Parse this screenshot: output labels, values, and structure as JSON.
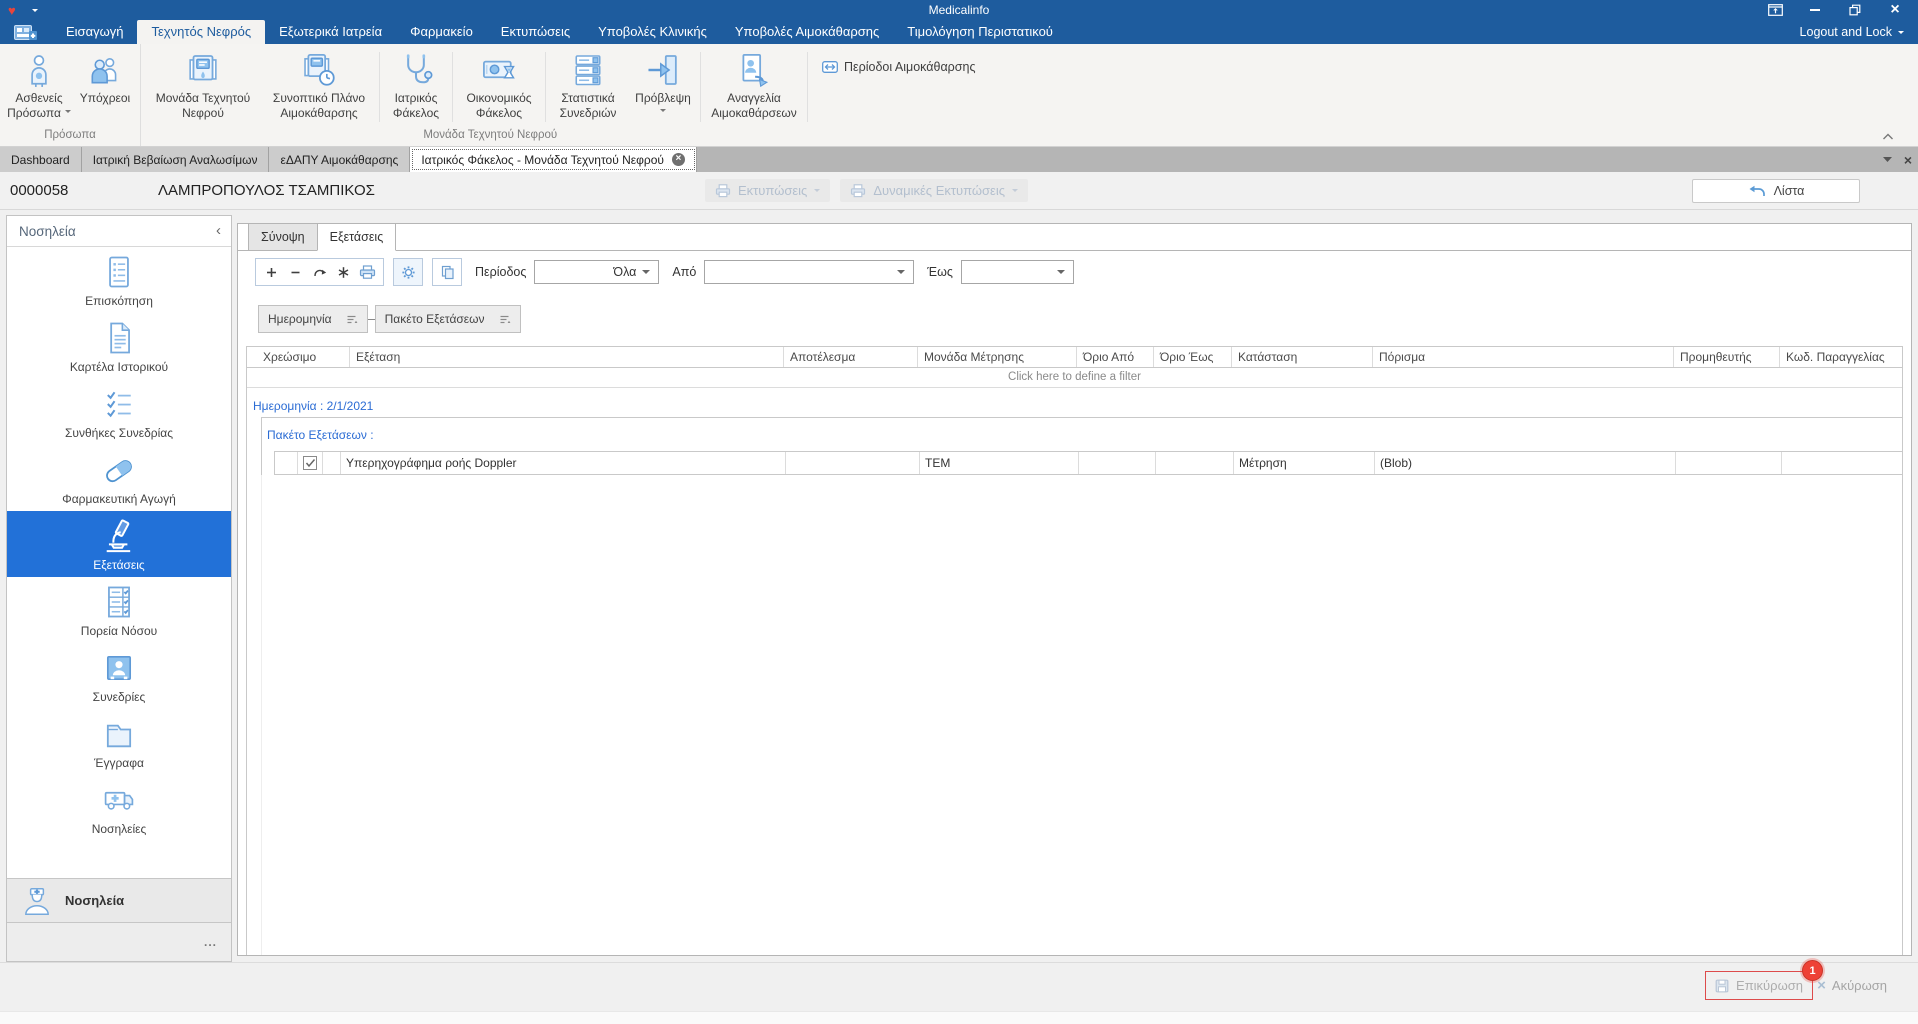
{
  "colors": {
    "titlebar_blue": "#1e5c9e",
    "selection_blue": "#2271d8",
    "link_blue": "#2b6cd4",
    "badge_red": "#ee4136",
    "icon_blue": "#76a9dc"
  },
  "titlebar": {
    "app_title": "Medicalinfo",
    "logout_label": "Logout and Lock"
  },
  "ribbon": {
    "tabs": [
      "Εισαγωγή",
      "Τεχνητός Νεφρός",
      "Εξωτερικά Ιατρεία",
      "Φαρμακείο",
      "Εκτυπώσεις",
      "Υποβολές Κλινικής",
      "Υποβολές Αιμοκάθαρσης",
      "Τιμολόγηση Περιστατικού"
    ],
    "active_tab": "Τεχνητός Νεφρός",
    "groups": [
      {
        "label": "Πρόσωπα",
        "buttons": [
          {
            "label": "Ασθενείς Πρόσωπα",
            "icon": "patient-icon",
            "dropdown": true
          },
          {
            "label": "Υπόχρεοι",
            "icon": "people-icon"
          }
        ]
      },
      {
        "label": "Μονάδα Τεχνητού Νεφρού",
        "buttons": [
          {
            "label": "Μονάδα Τεχνητού Νεφρού",
            "icon": "dialysis-machine-icon"
          },
          {
            "label": "Συνοπτικό Πλάνο Αιμοκάθαρσης",
            "icon": "dialysis-plan-icon"
          },
          {
            "label": "Ιατρικός Φάκελος",
            "icon": "stethoscope-icon"
          },
          {
            "label": "Οικονομικός Φάκελος",
            "icon": "money-icon"
          },
          {
            "label": "Στατιστικά Συνεδριών",
            "icon": "statistics-icon"
          },
          {
            "label": "Πρόβλεψη",
            "icon": "forecast-icon",
            "dropdown": true
          },
          {
            "label": "Αναγγελία Αιμοκαθάρσεων",
            "icon": "announcement-icon"
          },
          {
            "label": "Περίοδοι Αιμοκάθαρσης",
            "icon": "periods-icon",
            "small": true
          }
        ]
      }
    ]
  },
  "document_tabs": {
    "tabs": [
      "Dashboard",
      "Ιατρική Βεβαίωση Αναλωσίμων",
      "εΔΑΠΥ Αιμοκάθαρσης",
      "Ιατρικός Φάκελος - Μονάδα Τεχνητού Νεφρού"
    ],
    "active_tab": "Ιατρικός Φάκελος - Μονάδα Τεχνητού Νεφρού"
  },
  "patient_bar": {
    "patient_id": "0000058",
    "patient_name": "ΛΑΜΠΡΟΠΟΥΛΟΣ ΤΣΑΜΠΙΚΟΣ",
    "print_button": "Εκτυπώσεις",
    "dynamic_print_button": "Δυναμικές Εκτυπώσεις",
    "list_button": "Λίστα"
  },
  "sidebar": {
    "title": "Νοσηλεία",
    "items": [
      {
        "label": "Επισκόπηση",
        "icon": "overview-icon"
      },
      {
        "label": "Καρτέλα Ιστορικού",
        "icon": "history-card-icon"
      },
      {
        "label": "Συνθήκες Συνεδρίας",
        "icon": "session-conditions-icon"
      },
      {
        "label": "Φαρμακευτική Αγωγή",
        "icon": "medication-icon"
      },
      {
        "label": "Εξετάσεις",
        "icon": "microscope-icon",
        "selected": true
      },
      {
        "label": "Πορεία Νόσου",
        "icon": "disease-course-icon"
      },
      {
        "label": "Συνεδρίες",
        "icon": "sessions-icon"
      },
      {
        "label": "Έγγραφα",
        "icon": "documents-icon"
      },
      {
        "label": "Νοσηλείες",
        "icon": "ambulance-icon"
      }
    ],
    "footer_item": "Νοσηλεία",
    "overflow_button": "..."
  },
  "content": {
    "tabs": [
      "Σύνοψη",
      "Εξετάσεις"
    ],
    "active_tab": "Εξετάσεις",
    "toolbar": {
      "icons": [
        "add-icon",
        "remove-icon",
        "redo-icon",
        "asterisk-icon",
        "print-icon",
        "settings-gear-icon",
        "copy-icon"
      ],
      "period_label": "Περίοδος",
      "period_value": "Όλα",
      "from_label": "Από",
      "from_value": "",
      "to_label": "Έως",
      "to_value": ""
    },
    "group_by": [
      {
        "label": "Ημερομηνία"
      },
      {
        "label": "Πακέτο Εξετάσεων"
      }
    ],
    "table": {
      "columns": [
        "Χρεώσιμο",
        "Εξέταση",
        "Αποτέλεσμα",
        "Μονάδα Μέτρησης",
        "Όριο Από",
        "Όριο Έως",
        "Κατάσταση",
        "Πόρισμα",
        "Προμηθευτής",
        "Κωδ. Παραγγελίας"
      ],
      "filter_row_hint": "Click here to define a filter",
      "group_row_date": "Ημερομηνία : 2/1/2021",
      "group_row_package": "Πακέτο Εξετάσεων :",
      "rows": [
        {
          "billable_checked": true,
          "exam": "Υπερηχογράφημα ροής Doppler",
          "result": "",
          "unit": "ΤΕΜ",
          "limit_from": "",
          "limit_to": "",
          "status": "Μέτρηση",
          "finding": "(Blob)",
          "supplier": "",
          "order_code": ""
        }
      ]
    }
  },
  "footer": {
    "confirm_button": "Επικύρωση",
    "cancel_button": "Ακύρωση",
    "badge_count": "1"
  }
}
